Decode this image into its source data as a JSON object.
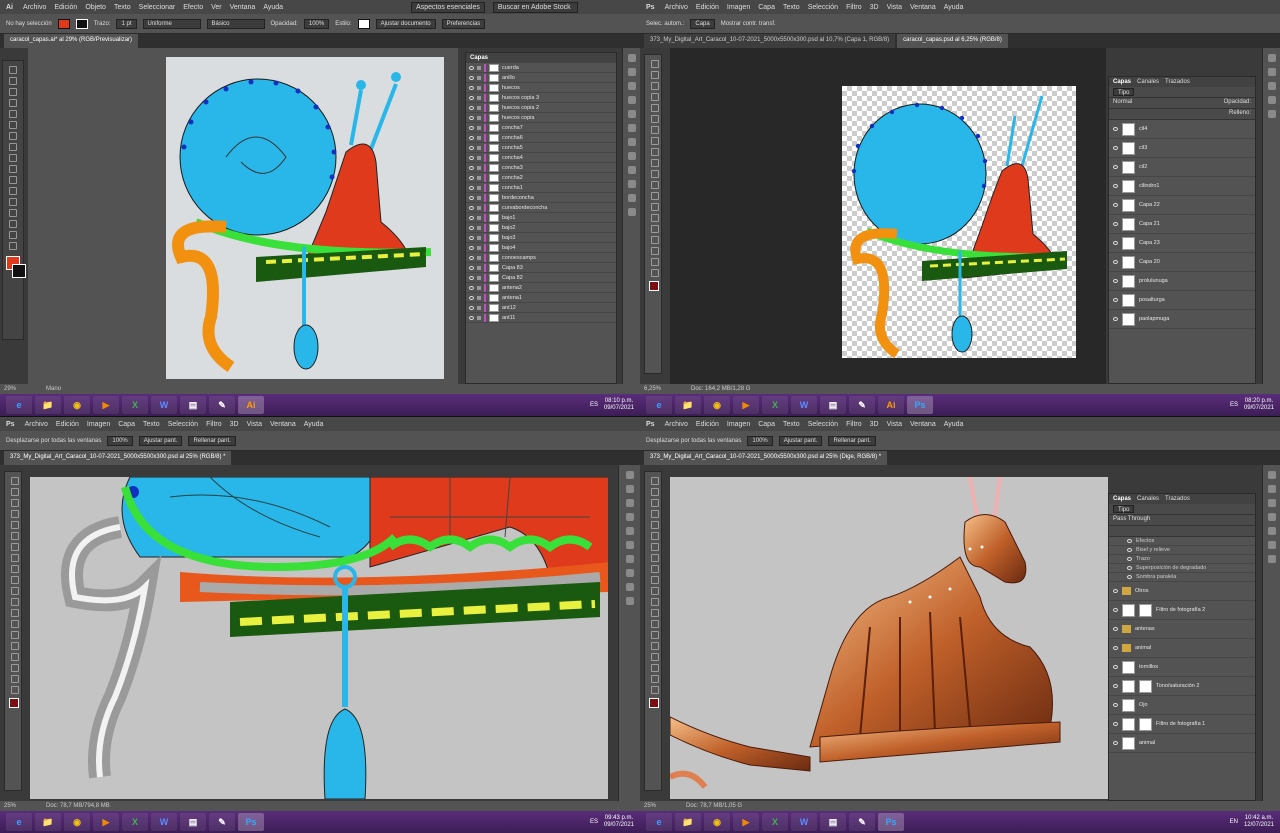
{
  "q1": {
    "app": "Ai",
    "menu": [
      "Archivo",
      "Edición",
      "Objeto",
      "Texto",
      "Seleccionar",
      "Efecto",
      "Ver",
      "Ventana",
      "Ayuda"
    ],
    "workspace": "Aspectos esenciales",
    "search_placeholder": "Buscar en Adobe Stock",
    "options": {
      "no_selection": "No hay selección",
      "stroke_label": "Trazo:",
      "stroke_weight": "1 pt",
      "uniform": "Uniforme",
      "basic": "Básico",
      "opacity_label": "Opacidad:",
      "opacity": "100%",
      "style_label": "Estilo:",
      "adjust": "Ajustar documento",
      "prefs": "Preferencias"
    },
    "tab": "caracol_capas.ai* al 29% (RGB/Previsualizar)",
    "layers_title": "Capas",
    "layers": [
      {
        "name": "cuerda",
        "color": "#c050c0"
      },
      {
        "name": "anillo",
        "color": "#c050c0"
      },
      {
        "name": "huecos",
        "color": "#c050c0"
      },
      {
        "name": "huecos copia 3",
        "color": "#c050c0"
      },
      {
        "name": "huecos copia 2",
        "color": "#c050c0"
      },
      {
        "name": "huecos copia",
        "color": "#c050c0"
      },
      {
        "name": "concha7",
        "color": "#c050c0"
      },
      {
        "name": "concha6",
        "color": "#c050c0"
      },
      {
        "name": "concha5",
        "color": "#c050c0"
      },
      {
        "name": "concha4",
        "color": "#c050c0"
      },
      {
        "name": "concha3",
        "color": "#c050c0"
      },
      {
        "name": "concha2",
        "color": "#c050c0"
      },
      {
        "name": "concha1",
        "color": "#c050c0"
      },
      {
        "name": "bordeconcha",
        "color": "#c050c0"
      },
      {
        "name": "curvabordeconcha",
        "color": "#c050c0"
      },
      {
        "name": "bajo1",
        "color": "#c050c0"
      },
      {
        "name": "bajo2",
        "color": "#c050c0"
      },
      {
        "name": "bajo3",
        "color": "#c050c0"
      },
      {
        "name": "bajo4",
        "color": "#c050c0"
      },
      {
        "name": "conoescamps",
        "color": "#c050c0"
      },
      {
        "name": "Capa 83",
        "color": "#c050c0"
      },
      {
        "name": "Capa 82",
        "color": "#c050c0"
      },
      {
        "name": "antena2",
        "color": "#c050c0"
      },
      {
        "name": "antena1",
        "color": "#c050c0"
      },
      {
        "name": "ant12",
        "color": "#c050c0"
      },
      {
        "name": "ant11",
        "color": "#c050c0"
      }
    ],
    "status": {
      "zoom": "29%",
      "tool": "Mano"
    },
    "taskbar": {
      "lang": "ES",
      "time": "08:10 p.m.",
      "date": "09/07/2021"
    }
  },
  "q2": {
    "app": "Ps",
    "menu": [
      "Archivo",
      "Edición",
      "Imagen",
      "Capa",
      "Texto",
      "Selección",
      "Filtro",
      "3D",
      "Vista",
      "Ventana",
      "Ayuda"
    ],
    "options": {
      "autosel": "Selec. autom.:",
      "capa": "Capa",
      "transform": "Mostrar contr. transf."
    },
    "tabs": [
      "373_My_Digital_Art_Caracol_10-07-2021_5000x5500x300.psd al 10,7% (Capa 1, RGB/8)",
      "caracol_capas.psd al 6,25% (RGB/8)"
    ],
    "panel_tabs": [
      "Capas",
      "Canales",
      "Trazados"
    ],
    "kind": "Tipo",
    "blend": "Normal",
    "opacity_label": "Opacidad:",
    "fill_label": "Relleno:",
    "layers": [
      "cil4",
      "cil3",
      "cil2",
      "cilindro1",
      "Capa 22",
      "Capa 21",
      "Capa 23",
      "Capa 20",
      "prolulunuga",
      "posalturga",
      "paolapmuga"
    ],
    "status": {
      "zoom": "6,25%",
      "doc": "Doc: 164,2 MB/1,28 G"
    },
    "taskbar": {
      "lang": "ES",
      "time": "08:20 p.m.",
      "date": "09/07/2021"
    }
  },
  "q3": {
    "app": "Ps",
    "menu": [
      "Archivo",
      "Edición",
      "Imagen",
      "Capa",
      "Texto",
      "Selección",
      "Filtro",
      "3D",
      "Vista",
      "Ventana",
      "Ayuda"
    ],
    "options": {
      "scroll_all": "Desplazarse por todas las ventanas",
      "zoom": "100%",
      "fit": "Ajustar pant.",
      "fill": "Rellenar pant."
    },
    "tab": "373_My_Digital_Art_Caracol_10-07-2021_5000x5500x300.psd al 25% (RGB/8) *",
    "status": {
      "zoom": "25%",
      "doc": "Doc: 78,7 MB/794,8 MB"
    },
    "taskbar": {
      "lang": "ES",
      "time": "09:43 p.m.",
      "date": "09/07/2021"
    }
  },
  "q4": {
    "app": "Ps",
    "menu": [
      "Archivo",
      "Edición",
      "Imagen",
      "Capa",
      "Texto",
      "Selección",
      "Filtro",
      "3D",
      "Vista",
      "Ventana",
      "Ayuda"
    ],
    "options": {
      "scroll_all": "Desplazarse por todas las ventanas",
      "zoom": "100%",
      "fit": "Ajustar pant.",
      "fill": "Rellenar pant."
    },
    "tab": "373_My_Digital_Art_Caracol_10-07-2021_5000x5500x300.psd al 25% (Dige, RGB/8) *",
    "panel_tabs": [
      "Capas",
      "Canales",
      "Trazados"
    ],
    "kind": "Tipo",
    "blend": "Pass Through",
    "layers": [
      {
        "name": "Efectos",
        "kind": "sub"
      },
      {
        "name": "Bisel y relieve",
        "kind": "sub"
      },
      {
        "name": "Trazo",
        "kind": "sub"
      },
      {
        "name": "Superposición de degradado",
        "kind": "sub"
      },
      {
        "name": "Sombra paralela",
        "kind": "sub"
      },
      {
        "name": "Otros",
        "kind": "grp"
      },
      {
        "name": "Filtro de fotografía 2",
        "kind": "adj"
      },
      {
        "name": "antenas",
        "kind": "grp"
      },
      {
        "name": "animal",
        "kind": "grp"
      },
      {
        "name": "tornillos",
        "kind": "px"
      },
      {
        "name": "Tono/saturación 2",
        "kind": "adj"
      },
      {
        "name": "Ojo",
        "kind": "px"
      },
      {
        "name": "Filtro de fotografía 1",
        "kind": "adj"
      },
      {
        "name": "animal",
        "kind": "px"
      }
    ],
    "status": {
      "zoom": "25%",
      "doc": "Doc: 78,7 MB/1,05 G"
    },
    "taskbar": {
      "lang": "EN",
      "time": "10:42 a.m.",
      "date": "12/07/2021"
    }
  },
  "taskbar_icons": [
    "e",
    "📁",
    "◉",
    "▶",
    "X",
    "W",
    "▤",
    "✎",
    "Ai",
    "Ps"
  ]
}
